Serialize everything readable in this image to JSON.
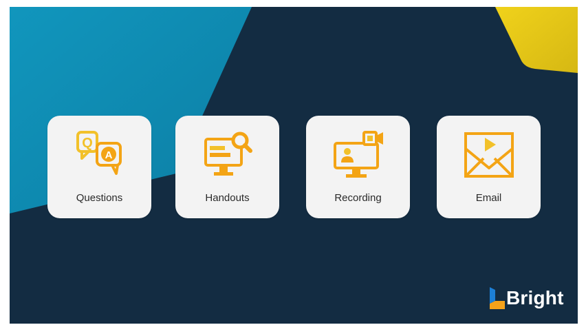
{
  "colors": {
    "background": "#132c42",
    "teal_shape": "#0f8fb5",
    "yellow_shape": "#e0c419",
    "card_bg": "#f3f3f3",
    "icon_orange": "#f3a415",
    "icon_yellow": "#f2c12a",
    "logo_blue": "#1d7fd6",
    "logo_orange": "#f5a21a"
  },
  "cards": [
    {
      "label": "Questions",
      "icon": "question-answer-icon"
    },
    {
      "label": "Handouts",
      "icon": "monitor-search-icon"
    },
    {
      "label": "Recording",
      "icon": "monitor-video-icon"
    },
    {
      "label": "Email",
      "icon": "email-video-icon"
    }
  ],
  "logo": {
    "text": "Bright"
  }
}
